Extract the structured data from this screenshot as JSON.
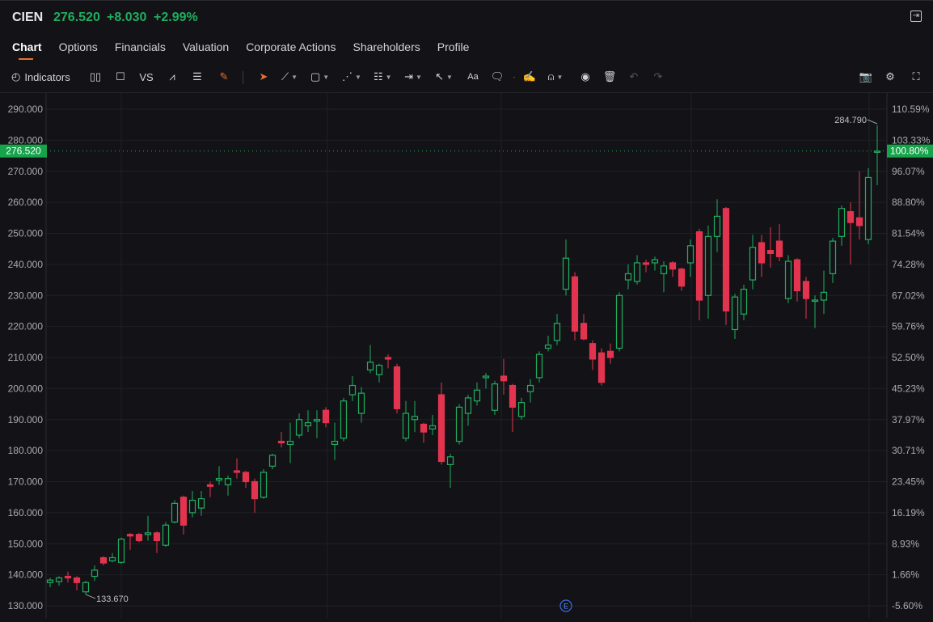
{
  "header": {
    "symbol": "CIEN",
    "price": "276.520",
    "change": "+8.030",
    "change_pct": "+2.99%",
    "exit_icon": "exit-fullscreen-icon"
  },
  "tabs": [
    {
      "label": "Chart",
      "active": true
    },
    {
      "label": "Options"
    },
    {
      "label": "Financials"
    },
    {
      "label": "Valuation"
    },
    {
      "label": "Corporate Actions"
    },
    {
      "label": "Shareholders"
    },
    {
      "label": "Profile"
    }
  ],
  "toolbar": {
    "indicators_label": "Indicators",
    "vs_label": "VS",
    "text_label": "Aa"
  },
  "colors": {
    "up": "#1fae5e",
    "down": "#e3344f",
    "bg": "#131317",
    "accent": "#e8712a"
  },
  "chart_data": {
    "type": "candlestick",
    "symbol": "CIEN",
    "y_ticks": [
      "290.000",
      "280.000",
      "270.000",
      "260.000",
      "250.000",
      "240.000",
      "230.000",
      "220.000",
      "210.000",
      "200.000",
      "190.000",
      "180.000",
      "170.000",
      "160.000",
      "150.000",
      "140.000",
      "130.000"
    ],
    "y_tick_values": [
      290,
      280,
      270,
      260,
      250,
      240,
      230,
      220,
      210,
      200,
      190,
      180,
      170,
      160,
      150,
      140,
      130
    ],
    "pct_ticks": [
      "110.59%",
      "103.33%",
      "96.07%",
      "88.80%",
      "81.54%",
      "74.28%",
      "67.02%",
      "59.76%",
      "52.50%",
      "45.23%",
      "37.97%",
      "30.71%",
      "23.45%",
      "16.19%",
      "8.93%",
      "1.66%",
      "-5.60%"
    ],
    "ylim": [
      128,
      296
    ],
    "last_price_label": "276.520",
    "last_price": 276.52,
    "last_pct_label": "100.80%",
    "high_label": "284.790",
    "low_label": "133.670",
    "earnings_marker": "E",
    "earnings_index": 58,
    "ohlc": [
      [
        137.5,
        139,
        136,
        138.3
      ],
      [
        137.8,
        139.5,
        136.5,
        139
      ],
      [
        139.5,
        141,
        137.5,
        139
      ],
      [
        139,
        139.5,
        135,
        137.5
      ],
      [
        134.5,
        138,
        133.67,
        137.5
      ],
      [
        139.5,
        143,
        138,
        141.5
      ],
      [
        145.5,
        146,
        143,
        143.8
      ],
      [
        144.5,
        147,
        144,
        145.5
      ],
      [
        144,
        152,
        143.5,
        151.5
      ],
      [
        153,
        153.5,
        148,
        152.5
      ],
      [
        153,
        153.5,
        150.5,
        151
      ],
      [
        153,
        159,
        151,
        153.5
      ],
      [
        153.5,
        154,
        147,
        151
      ],
      [
        149.5,
        157,
        149,
        156
      ],
      [
        157,
        164,
        156.5,
        163
      ],
      [
        165,
        165.5,
        153,
        156
      ],
      [
        160,
        167,
        158.5,
        164
      ],
      [
        161.5,
        167,
        159,
        164.5
      ],
      [
        169,
        170,
        165,
        168.5
      ],
      [
        170.5,
        175,
        169,
        171
      ],
      [
        169,
        172,
        165.5,
        171
      ],
      [
        173.5,
        177.5,
        171,
        173
      ],
      [
        173,
        173.5,
        168,
        170
      ],
      [
        170,
        171,
        160,
        164.5
      ],
      [
        165,
        174,
        164.5,
        173
      ],
      [
        175,
        179,
        174,
        178.5
      ],
      [
        183,
        186,
        181,
        182.5
      ],
      [
        182,
        189,
        176,
        183
      ],
      [
        185,
        192,
        184,
        190
      ],
      [
        188,
        193,
        186,
        189
      ],
      [
        189.5,
        193,
        184,
        190
      ],
      [
        193,
        194,
        187.5,
        189
      ],
      [
        182,
        189,
        177,
        183
      ],
      [
        184,
        197,
        183,
        196
      ],
      [
        198,
        204,
        196,
        201
      ],
      [
        192,
        200.5,
        189,
        198.5
      ],
      [
        206,
        214,
        205,
        208.5
      ],
      [
        204.5,
        208,
        202,
        207.5
      ],
      [
        210,
        211,
        206.5,
        209.5
      ],
      [
        207,
        208,
        192,
        193.5
      ],
      [
        184,
        196,
        183,
        192
      ],
      [
        190,
        196,
        186,
        191
      ],
      [
        188.5,
        189,
        182.5,
        186
      ],
      [
        187,
        191.5,
        185,
        188
      ],
      [
        198,
        202,
        175.5,
        176.5
      ],
      [
        175.5,
        179,
        168,
        178
      ],
      [
        183,
        195,
        182,
        194
      ],
      [
        192,
        198,
        188,
        197
      ],
      [
        196,
        202,
        194.5,
        199.5
      ],
      [
        203.5,
        205,
        200,
        204
      ],
      [
        193,
        202.5,
        191.5,
        201.5
      ],
      [
        204,
        209.5,
        198,
        202.5
      ],
      [
        201,
        201.5,
        186,
        194
      ],
      [
        191,
        197,
        190,
        195.5
      ],
      [
        199,
        203,
        195.5,
        201
      ],
      [
        203.5,
        212,
        202,
        211
      ],
      [
        213,
        217,
        212,
        214
      ],
      [
        215.5,
        224,
        214,
        221
      ],
      [
        232,
        248,
        230,
        242
      ],
      [
        236,
        237.5,
        215.5,
        218.5
      ],
      [
        221,
        224,
        215.5,
        216
      ],
      [
        214.5,
        215.5,
        206,
        209.5
      ],
      [
        211.5,
        213,
        201,
        202
      ],
      [
        212,
        214.5,
        208,
        210
      ],
      [
        213,
        231,
        212,
        230
      ],
      [
        235,
        240,
        232,
        237
      ],
      [
        234.5,
        243,
        233.5,
        240.5
      ],
      [
        240.5,
        241.5,
        237.5,
        240
      ],
      [
        240.5,
        242.5,
        238,
        241.5
      ],
      [
        237,
        241,
        231,
        239.5
      ],
      [
        240.5,
        241,
        236,
        238.5
      ],
      [
        238.5,
        239,
        231.5,
        233
      ],
      [
        240.5,
        248,
        236,
        246
      ],
      [
        250.5,
        251.5,
        222,
        228.5
      ],
      [
        230,
        252.5,
        222.5,
        249
      ],
      [
        249,
        261,
        244,
        255.5
      ],
      [
        258,
        258.5,
        220.5,
        225
      ],
      [
        219,
        230.5,
        216,
        229.5
      ],
      [
        224,
        233.5,
        222,
        232
      ],
      [
        235,
        249.5,
        232,
        245.5
      ],
      [
        247,
        249.5,
        236,
        240.5
      ],
      [
        244.5,
        252,
        239,
        243.5
      ],
      [
        247.5,
        253,
        241,
        242.5
      ],
      [
        229,
        243,
        227.5,
        241
      ],
      [
        241.5,
        242,
        228,
        231.5
      ],
      [
        234.5,
        236,
        222.5,
        229
      ],
      [
        228.5,
        230,
        219.5,
        228.5
      ],
      [
        228.5,
        238,
        224,
        231
      ],
      [
        237,
        248.5,
        234,
        247.5
      ],
      [
        249,
        259,
        246,
        258
      ],
      [
        257,
        260,
        240,
        253.5
      ],
      [
        255,
        270,
        248,
        252.5
      ],
      [
        248,
        271,
        246.5,
        268
      ],
      [
        276.5,
        284.79,
        265.5,
        276.5
      ]
    ]
  }
}
